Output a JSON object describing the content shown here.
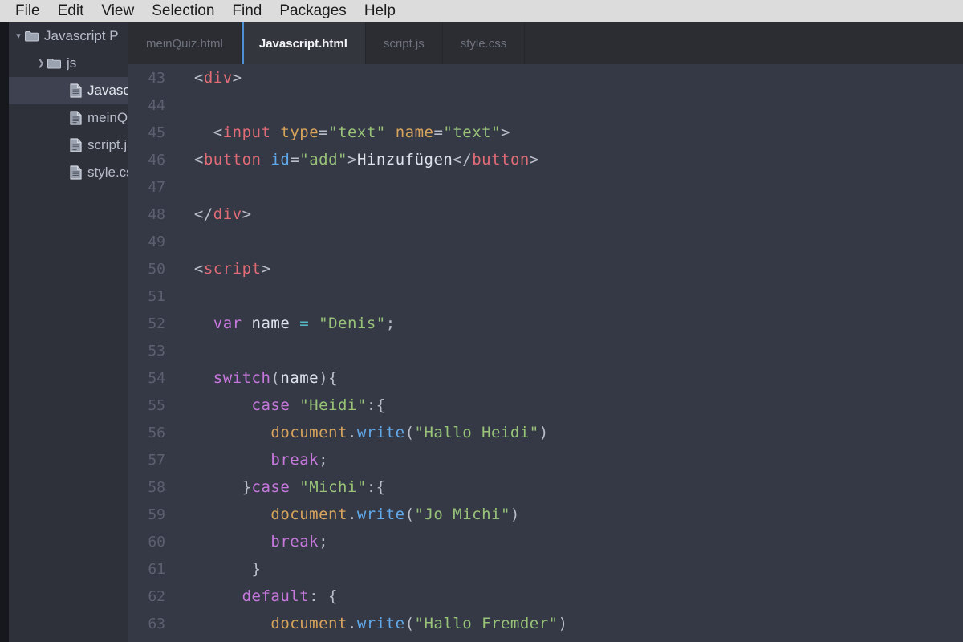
{
  "menubar": {
    "items": [
      {
        "label": "File"
      },
      {
        "label": "Edit"
      },
      {
        "label": "View"
      },
      {
        "label": "Selection"
      },
      {
        "label": "Find"
      },
      {
        "label": "Packages"
      },
      {
        "label": "Help"
      }
    ]
  },
  "sidebar": {
    "tree": [
      {
        "label": "Javascript P",
        "type": "folder",
        "twisty": "▾",
        "depth": 0,
        "selected": false
      },
      {
        "label": "js",
        "type": "folder",
        "twisty": "❯",
        "depth": 1,
        "selected": false
      },
      {
        "label": "Javascrip",
        "type": "file",
        "twisty": "",
        "depth": 2,
        "selected": true
      },
      {
        "label": "meinQu",
        "type": "file",
        "twisty": "",
        "depth": 2,
        "selected": false
      },
      {
        "label": "script.js",
        "type": "file",
        "twisty": "",
        "depth": 2,
        "selected": false
      },
      {
        "label": "style.css",
        "type": "file",
        "twisty": "",
        "depth": 2,
        "selected": false
      }
    ]
  },
  "tabs": [
    {
      "label": "meinQuiz.html",
      "active": false
    },
    {
      "label": "Javascript.html",
      "active": true
    },
    {
      "label": "script.js",
      "active": false
    },
    {
      "label": "style.css",
      "active": false
    }
  ],
  "editor": {
    "active_file": "Javascript.html",
    "first_line": 43,
    "lines": [
      {
        "n": "43",
        "tokens": [
          {
            "t": "  ",
            "c": "t-punc"
          },
          {
            "t": "<",
            "c": "t-punc"
          },
          {
            "t": "div",
            "c": "t-tag"
          },
          {
            "t": ">",
            "c": "t-punc"
          }
        ]
      },
      {
        "n": "44",
        "tokens": []
      },
      {
        "n": "45",
        "tokens": [
          {
            "t": "    ",
            "c": "t-punc"
          },
          {
            "t": "<",
            "c": "t-punc"
          },
          {
            "t": "input",
            "c": "t-tag"
          },
          {
            "t": " ",
            "c": "t-punc"
          },
          {
            "t": "type",
            "c": "t-attr"
          },
          {
            "t": "=",
            "c": "t-punc"
          },
          {
            "t": "\"text\"",
            "c": "t-str"
          },
          {
            "t": " ",
            "c": "t-punc"
          },
          {
            "t": "name",
            "c": "t-attr"
          },
          {
            "t": "=",
            "c": "t-punc"
          },
          {
            "t": "\"text\"",
            "c": "t-str"
          },
          {
            "t": ">",
            "c": "t-punc"
          }
        ]
      },
      {
        "n": "46",
        "tokens": [
          {
            "t": "  ",
            "c": "t-punc"
          },
          {
            "t": "<",
            "c": "t-punc"
          },
          {
            "t": "button",
            "c": "t-tag"
          },
          {
            "t": " ",
            "c": "t-punc"
          },
          {
            "t": "id",
            "c": "t-attr2"
          },
          {
            "t": "=",
            "c": "t-punc"
          },
          {
            "t": "\"add\"",
            "c": "t-str"
          },
          {
            "t": ">",
            "c": "t-punc"
          },
          {
            "t": "Hinzufügen",
            "c": "t-txt"
          },
          {
            "t": "</",
            "c": "t-punc"
          },
          {
            "t": "button",
            "c": "t-tag"
          },
          {
            "t": ">",
            "c": "t-punc"
          }
        ]
      },
      {
        "n": "47",
        "tokens": []
      },
      {
        "n": "48",
        "tokens": [
          {
            "t": "  ",
            "c": "t-punc"
          },
          {
            "t": "</",
            "c": "t-punc"
          },
          {
            "t": "div",
            "c": "t-tag"
          },
          {
            "t": ">",
            "c": "t-punc"
          }
        ]
      },
      {
        "n": "49",
        "tokens": []
      },
      {
        "n": "50",
        "tokens": [
          {
            "t": "  ",
            "c": "t-punc"
          },
          {
            "t": "<",
            "c": "t-punc"
          },
          {
            "t": "script",
            "c": "t-tag"
          },
          {
            "t": ">",
            "c": "t-punc"
          }
        ]
      },
      {
        "n": "51",
        "tokens": []
      },
      {
        "n": "52",
        "tokens": [
          {
            "t": "    ",
            "c": "t-punc"
          },
          {
            "t": "var",
            "c": "t-kw"
          },
          {
            "t": " ",
            "c": "t-punc"
          },
          {
            "t": "name",
            "c": "t-var"
          },
          {
            "t": " ",
            "c": "t-punc"
          },
          {
            "t": "=",
            "c": "t-op"
          },
          {
            "t": " ",
            "c": "t-punc"
          },
          {
            "t": "\"Denis\"",
            "c": "t-str"
          },
          {
            "t": ";",
            "c": "t-punc"
          }
        ]
      },
      {
        "n": "53",
        "tokens": []
      },
      {
        "n": "54",
        "tokens": [
          {
            "t": "    ",
            "c": "t-punc"
          },
          {
            "t": "switch",
            "c": "t-kw"
          },
          {
            "t": "(",
            "c": "t-punc"
          },
          {
            "t": "name",
            "c": "t-var"
          },
          {
            "t": "){",
            "c": "t-punc"
          }
        ]
      },
      {
        "n": "55",
        "tokens": [
          {
            "t": "        ",
            "c": "t-punc"
          },
          {
            "t": "case",
            "c": "t-kw"
          },
          {
            "t": " ",
            "c": "t-punc"
          },
          {
            "t": "\"Heidi\"",
            "c": "t-str"
          },
          {
            "t": ":{",
            "c": "t-punc"
          }
        ]
      },
      {
        "n": "56",
        "tokens": [
          {
            "t": "          ",
            "c": "t-punc"
          },
          {
            "t": "document",
            "c": "t-obj"
          },
          {
            "t": ".",
            "c": "t-punc"
          },
          {
            "t": "write",
            "c": "t-fn"
          },
          {
            "t": "(",
            "c": "t-punc"
          },
          {
            "t": "\"Hallo Heidi\"",
            "c": "t-str"
          },
          {
            "t": ")",
            "c": "t-punc"
          }
        ]
      },
      {
        "n": "57",
        "tokens": [
          {
            "t": "          ",
            "c": "t-punc"
          },
          {
            "t": "break",
            "c": "t-kw"
          },
          {
            "t": ";",
            "c": "t-punc"
          }
        ]
      },
      {
        "n": "58",
        "tokens": [
          {
            "t": "       ",
            "c": "t-punc"
          },
          {
            "t": "}",
            "c": "t-punc"
          },
          {
            "t": "case",
            "c": "t-kw"
          },
          {
            "t": " ",
            "c": "t-punc"
          },
          {
            "t": "\"Michi\"",
            "c": "t-str"
          },
          {
            "t": ":{",
            "c": "t-punc"
          }
        ]
      },
      {
        "n": "59",
        "tokens": [
          {
            "t": "          ",
            "c": "t-punc"
          },
          {
            "t": "document",
            "c": "t-obj"
          },
          {
            "t": ".",
            "c": "t-punc"
          },
          {
            "t": "write",
            "c": "t-fn"
          },
          {
            "t": "(",
            "c": "t-punc"
          },
          {
            "t": "\"Jo Michi\"",
            "c": "t-str"
          },
          {
            "t": ")",
            "c": "t-punc"
          }
        ]
      },
      {
        "n": "60",
        "tokens": [
          {
            "t": "          ",
            "c": "t-punc"
          },
          {
            "t": "break",
            "c": "t-kw"
          },
          {
            "t": ";",
            "c": "t-punc"
          }
        ]
      },
      {
        "n": "61",
        "tokens": [
          {
            "t": "        ",
            "c": "t-punc"
          },
          {
            "t": "}",
            "c": "t-punc"
          }
        ]
      },
      {
        "n": "62",
        "tokens": [
          {
            "t": "       ",
            "c": "t-punc"
          },
          {
            "t": "default",
            "c": "t-kw"
          },
          {
            "t": ": {",
            "c": "t-punc"
          }
        ]
      },
      {
        "n": "63",
        "tokens": [
          {
            "t": "          ",
            "c": "t-punc"
          },
          {
            "t": "document",
            "c": "t-obj"
          },
          {
            "t": ".",
            "c": "t-punc"
          },
          {
            "t": "write",
            "c": "t-fn"
          },
          {
            "t": "(",
            "c": "t-punc"
          },
          {
            "t": "\"Hallo Fremder\"",
            "c": "t-str"
          },
          {
            "t": ")",
            "c": "t-punc"
          }
        ]
      }
    ]
  },
  "colors": {
    "menubar_bg": "#dcdcdc",
    "sidebar_bg": "#2e313a",
    "tabbar_bg": "#2b2d33",
    "editor_bg": "#353845",
    "active_tab_accent": "#4d90d6",
    "selection_bg": "#3d4150"
  }
}
